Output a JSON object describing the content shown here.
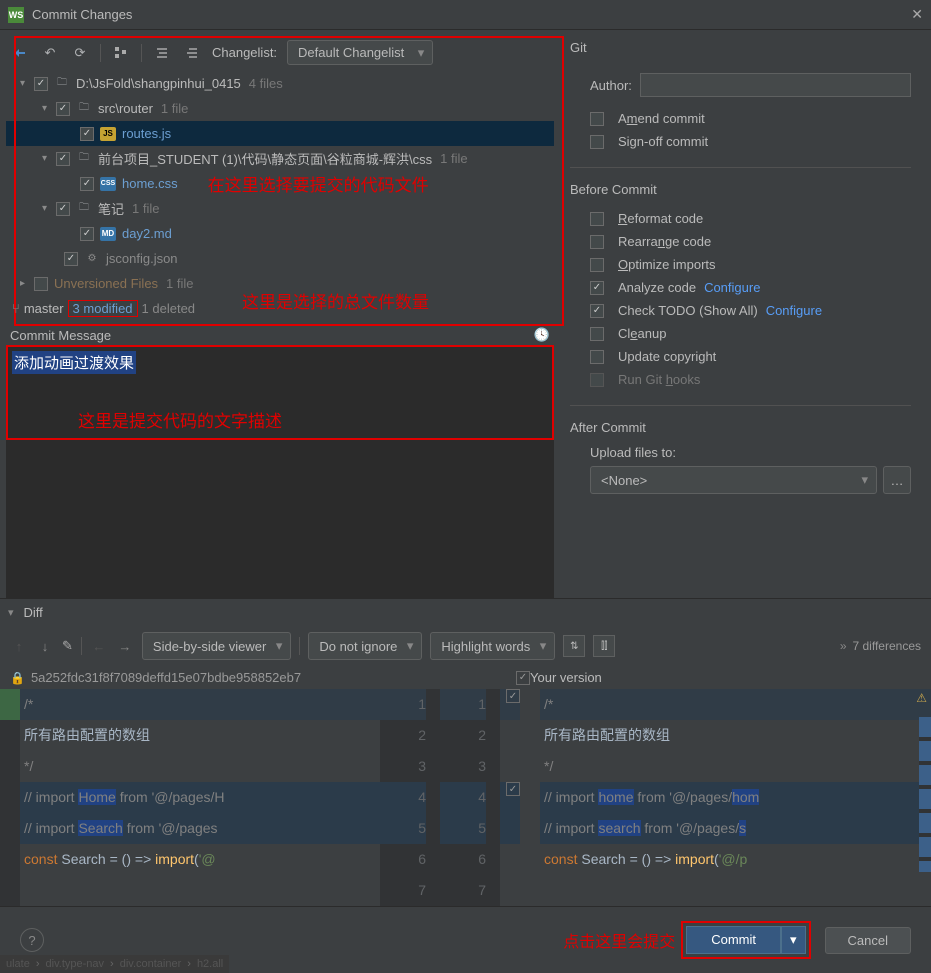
{
  "title": "Commit Changes",
  "toolbar": {
    "changelist_label": "Changelist:",
    "changelist_value": "Default Changelist",
    "git_label": "Git"
  },
  "tree": {
    "root": {
      "name": "D:\\JsFold\\shangpinhui_0415",
      "meta": "4 files"
    },
    "src_router": {
      "name": "src\\router",
      "meta": "1 file"
    },
    "routes": {
      "name": "routes.js"
    },
    "front_proj": {
      "name": "前台项目_STUDENT (1)\\代码\\静态页面\\谷粒商城-辉洪\\css",
      "meta": "1 file"
    },
    "home_css": {
      "name": "home.css"
    },
    "notes": {
      "name": "笔记",
      "meta": "1 file"
    },
    "day2": {
      "name": "day2.md"
    },
    "jsconfig": {
      "name": "jsconfig.json"
    },
    "unversioned": {
      "name": "Unversioned Files",
      "meta": "1 file"
    }
  },
  "annotations": {
    "select_files": "在这里选择要提交的代码文件",
    "total_files": "这里是选择的总文件数量",
    "commit_desc": "这里是提交代码的文字描述",
    "click_commit": "点击这里会提交"
  },
  "branch": {
    "name": "master",
    "modified": "3 modified",
    "deleted": "1 deleted"
  },
  "commit_msg": {
    "header": "Commit Message",
    "text": "添加动画过渡效果"
  },
  "right": {
    "author_label": "Author:",
    "amend": "Amend commit",
    "signoff": "Sign-off commit",
    "before_title": "Before Commit",
    "reformat": "Reformat code",
    "rearrange": "Rearrange code",
    "optimize": "Optimize imports",
    "analyze": "Analyze code",
    "configure": "Configure",
    "check_todo": "Check TODO (Show All)",
    "cleanup": "Cleanup",
    "update_copyright": "Update copyright",
    "run_hooks": "Run Git hooks",
    "after_title": "After Commit",
    "upload_to": "Upload files to:",
    "upload_value": "<None>"
  },
  "diff": {
    "title": "Diff",
    "view_mode": "Side-by-side viewer",
    "ignore_mode": "Do not ignore",
    "highlight_mode": "Highlight words",
    "count": "7 differences",
    "revision": "5a252fdc31f8f7089deffd15e07bdbe958852eb7",
    "your_version": "Your version"
  },
  "code": {
    "l1": "/*",
    "l2": "所有路由配置的数组",
    "l3": "*/",
    "l4_left": "// import Home from '@/pages/H",
    "l4_right": "// import home from '@/pages/hom",
    "l5_left": "// import Search from '@/pages",
    "l5_right": "// import search from '@/pages/s",
    "l6_left": "const Search = () => import('@",
    "l6_right": "const Search = () => import('@/p",
    "hl_home_l": "Home",
    "hl_home_r": "home",
    "hl_search_l": "Search",
    "hl_search_r": "search"
  },
  "buttons": {
    "commit": "Commit",
    "cancel": "Cancel"
  },
  "breadcrumb": {
    "a": "ulate",
    "b": "div.type-nav",
    "c": "div.container",
    "d": "h2.all"
  }
}
